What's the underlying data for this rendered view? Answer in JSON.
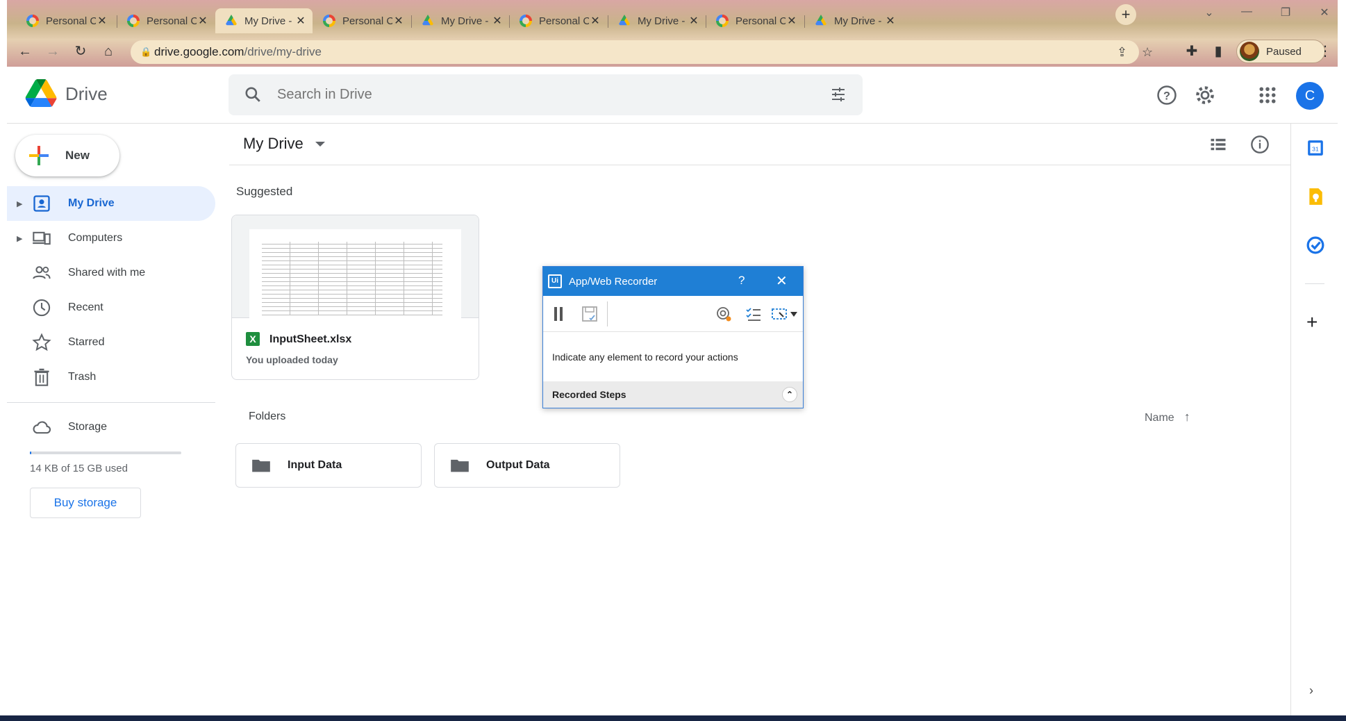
{
  "browser": {
    "tabs": [
      {
        "title": "Personal Cloud",
        "favicon": "google-icon",
        "active": false
      },
      {
        "title": "Personal Cloud",
        "favicon": "google-icon",
        "active": false
      },
      {
        "title": "My Drive - Go",
        "favicon": "drive-icon",
        "active": true
      },
      {
        "title": "Personal Cloud",
        "favicon": "google-icon",
        "active": false
      },
      {
        "title": "My Drive - Go",
        "favicon": "drive-icon",
        "active": false
      },
      {
        "title": "Personal Cloud",
        "favicon": "google-icon",
        "active": false
      },
      {
        "title": "My Drive - Go",
        "favicon": "drive-icon",
        "active": false
      },
      {
        "title": "Personal Cloud",
        "favicon": "google-icon",
        "active": false
      },
      {
        "title": "My Drive - Go",
        "favicon": "drive-icon",
        "active": false
      }
    ],
    "url_host": "drive.google.com",
    "url_path": "/drive/my-drive",
    "profile_status": "Paused"
  },
  "drive": {
    "brand": "Drive",
    "search_placeholder": "Search in Drive",
    "account_initial": "C",
    "new_label": "New",
    "nav": [
      {
        "label": "My Drive",
        "icon": "my-drive-icon",
        "active": true,
        "expandable": true
      },
      {
        "label": "Computers",
        "icon": "computers-icon",
        "active": false,
        "expandable": true
      },
      {
        "label": "Shared with me",
        "icon": "shared-icon",
        "active": false,
        "expandable": false
      },
      {
        "label": "Recent",
        "icon": "clock-icon",
        "active": false,
        "expandable": false
      },
      {
        "label": "Starred",
        "icon": "star-icon",
        "active": false,
        "expandable": false
      },
      {
        "label": "Trash",
        "icon": "trash-icon",
        "active": false,
        "expandable": false
      }
    ],
    "storage": {
      "label": "Storage",
      "used_text": "14 KB of 15 GB used",
      "used_fraction": 0.001,
      "buy_label": "Buy storage"
    },
    "main": {
      "title": "My Drive",
      "suggested_label": "Suggested",
      "suggested_file": {
        "name": "InputSheet.xlsx",
        "meta": "You uploaded today",
        "type_badge": "X"
      },
      "folders_label": "Folders",
      "sort_label": "Name",
      "folders": [
        "Input Data",
        "Output Data"
      ]
    }
  },
  "recorder": {
    "title": "App/Web Recorder",
    "logo_text": "Ui",
    "help": "?",
    "message": "Indicate any element to record your actions",
    "steps_label": "Recorded Steps"
  },
  "colors": {
    "accent": "#1a73e8",
    "active_nav_bg": "#e8f0fe",
    "recorder_title": "#1f7fd5"
  }
}
